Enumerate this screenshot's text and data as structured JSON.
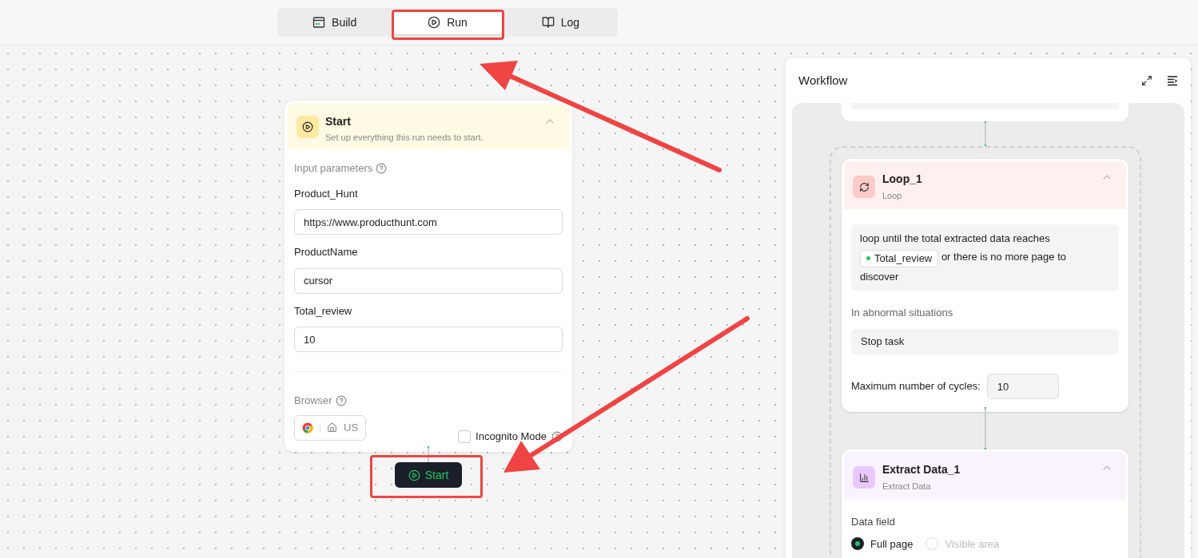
{
  "tabs": [
    {
      "label": "Build",
      "kind": "build",
      "selected": false
    },
    {
      "label": "Run",
      "kind": "run",
      "selected": true
    },
    {
      "label": "Log",
      "kind": "log",
      "selected": false
    }
  ],
  "start_node": {
    "title": "Start",
    "subtitle": "Set up everything this run needs to start.",
    "expanded": true,
    "section_label": "Input parameters",
    "params": [
      {
        "label": "Product_Hunt",
        "value": "https://www.producthunt.com"
      },
      {
        "label": "ProductName",
        "value": "cursor"
      },
      {
        "label": "Total_review",
        "value": "10"
      }
    ],
    "browser_label": "Browser",
    "browser_region": "US",
    "incognito": {
      "label": "Incognito Mode",
      "checked": false
    }
  },
  "run_button": "Start",
  "workflow": {
    "title": "Workflow",
    "loop": {
      "title": "Loop_1",
      "subtitle": "Loop",
      "expanded": true,
      "condition_start": "loop until the total extracted data reaches",
      "variable": "Total_review",
      "condition_end": "or there is no more page to discover",
      "abnormal_label": "In abnormal situations",
      "abnormal_value": "Stop task",
      "max_cycles_label": "Maximum number of cycles:",
      "max_cycles_value": "10"
    },
    "extract": {
      "title": "Extract Data_1",
      "subtitle": "Extract Data",
      "expanded": true,
      "field_label": "Data field",
      "options": [
        {
          "label": "Full page",
          "selected": true,
          "disabled": false
        },
        {
          "label": "Visible area",
          "selected": false,
          "disabled": true
        }
      ]
    }
  }
}
